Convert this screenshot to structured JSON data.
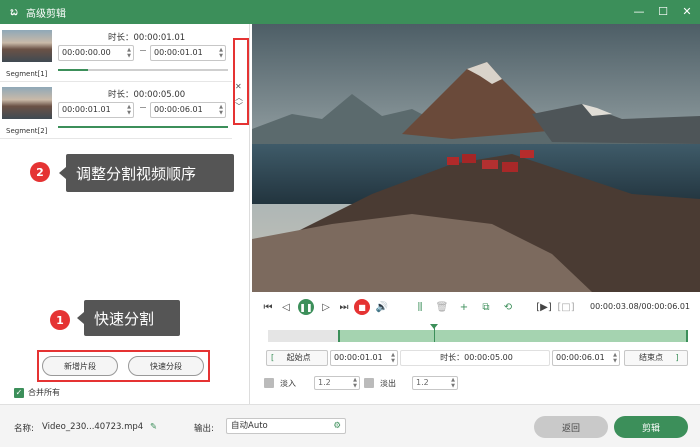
{
  "app": {
    "title": "高级剪辑"
  },
  "segments": [
    {
      "label": "Segment[1]",
      "duration": "时长：00:00:01.01",
      "start": "00:00:00.00",
      "end": "00:00:01.01"
    },
    {
      "label": "Segment[2]",
      "duration": "时长：00:00:05.00",
      "start": "00:00:01.01",
      "end": "00:00:06.01"
    }
  ],
  "annotations": {
    "step1_number": "1",
    "step1_text": "快速分割",
    "step2_number": "2",
    "step2_text": "调整分割视频顺序"
  },
  "left_buttons": {
    "new_segment": "新增片段",
    "quick_split": "快速分段"
  },
  "merge_all": "合并所有",
  "player": {
    "timecode": "00:00:03.08/00:00:06.01",
    "progress_fraction": 0.55
  },
  "range": {
    "start_label": "起始点",
    "start_value": "00:00:01.01",
    "duration": "时长：00:00:05.00",
    "end_value": "00:00:06.01",
    "end_label": "结束点"
  },
  "fade": {
    "fade_in_label": "淡入",
    "fade_in_value": "1.2",
    "fade_out_label": "淡出",
    "fade_out_value": "1.2"
  },
  "bottom": {
    "name_label": "名称:",
    "name_value": "Video_230...40723.mp4",
    "output_label": "输出:",
    "output_value": "自动Auto",
    "back_button": "返回",
    "cut_button": "剪辑"
  },
  "colors": {
    "accent": "#3c8f5a",
    "highlight": "#e53333"
  }
}
